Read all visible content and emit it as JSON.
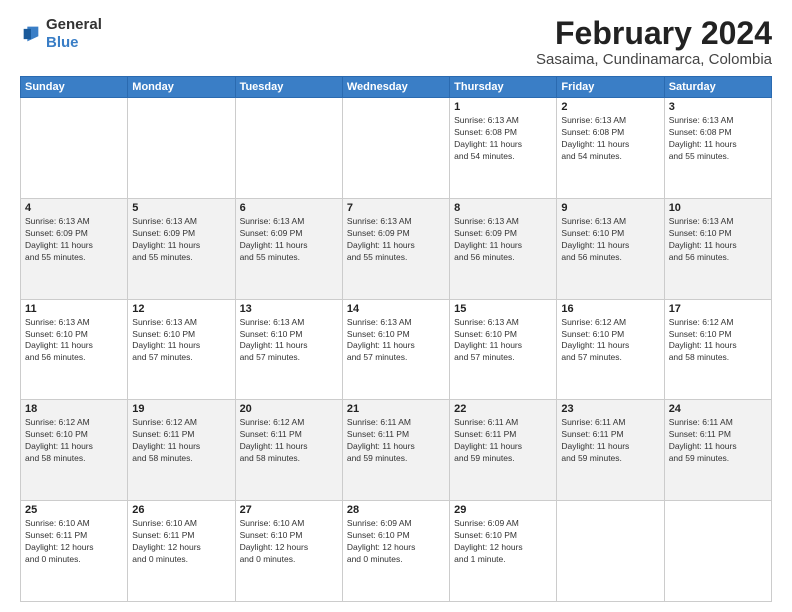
{
  "logo": {
    "general": "General",
    "blue": "Blue"
  },
  "title": {
    "month": "February 2024",
    "location": "Sasaima, Cundinamarca, Colombia"
  },
  "weekdays": [
    "Sunday",
    "Monday",
    "Tuesday",
    "Wednesday",
    "Thursday",
    "Friday",
    "Saturday"
  ],
  "weeks": [
    [
      {
        "day": "",
        "info": ""
      },
      {
        "day": "",
        "info": ""
      },
      {
        "day": "",
        "info": ""
      },
      {
        "day": "",
        "info": ""
      },
      {
        "day": "1",
        "info": "Sunrise: 6:13 AM\nSunset: 6:08 PM\nDaylight: 11 hours\nand 54 minutes."
      },
      {
        "day": "2",
        "info": "Sunrise: 6:13 AM\nSunset: 6:08 PM\nDaylight: 11 hours\nand 54 minutes."
      },
      {
        "day": "3",
        "info": "Sunrise: 6:13 AM\nSunset: 6:08 PM\nDaylight: 11 hours\nand 55 minutes."
      }
    ],
    [
      {
        "day": "4",
        "info": "Sunrise: 6:13 AM\nSunset: 6:09 PM\nDaylight: 11 hours\nand 55 minutes."
      },
      {
        "day": "5",
        "info": "Sunrise: 6:13 AM\nSunset: 6:09 PM\nDaylight: 11 hours\nand 55 minutes."
      },
      {
        "day": "6",
        "info": "Sunrise: 6:13 AM\nSunset: 6:09 PM\nDaylight: 11 hours\nand 55 minutes."
      },
      {
        "day": "7",
        "info": "Sunrise: 6:13 AM\nSunset: 6:09 PM\nDaylight: 11 hours\nand 55 minutes."
      },
      {
        "day": "8",
        "info": "Sunrise: 6:13 AM\nSunset: 6:09 PM\nDaylight: 11 hours\nand 56 minutes."
      },
      {
        "day": "9",
        "info": "Sunrise: 6:13 AM\nSunset: 6:10 PM\nDaylight: 11 hours\nand 56 minutes."
      },
      {
        "day": "10",
        "info": "Sunrise: 6:13 AM\nSunset: 6:10 PM\nDaylight: 11 hours\nand 56 minutes."
      }
    ],
    [
      {
        "day": "11",
        "info": "Sunrise: 6:13 AM\nSunset: 6:10 PM\nDaylight: 11 hours\nand 56 minutes."
      },
      {
        "day": "12",
        "info": "Sunrise: 6:13 AM\nSunset: 6:10 PM\nDaylight: 11 hours\nand 57 minutes."
      },
      {
        "day": "13",
        "info": "Sunrise: 6:13 AM\nSunset: 6:10 PM\nDaylight: 11 hours\nand 57 minutes."
      },
      {
        "day": "14",
        "info": "Sunrise: 6:13 AM\nSunset: 6:10 PM\nDaylight: 11 hours\nand 57 minutes."
      },
      {
        "day": "15",
        "info": "Sunrise: 6:13 AM\nSunset: 6:10 PM\nDaylight: 11 hours\nand 57 minutes."
      },
      {
        "day": "16",
        "info": "Sunrise: 6:12 AM\nSunset: 6:10 PM\nDaylight: 11 hours\nand 57 minutes."
      },
      {
        "day": "17",
        "info": "Sunrise: 6:12 AM\nSunset: 6:10 PM\nDaylight: 11 hours\nand 58 minutes."
      }
    ],
    [
      {
        "day": "18",
        "info": "Sunrise: 6:12 AM\nSunset: 6:10 PM\nDaylight: 11 hours\nand 58 minutes."
      },
      {
        "day": "19",
        "info": "Sunrise: 6:12 AM\nSunset: 6:11 PM\nDaylight: 11 hours\nand 58 minutes."
      },
      {
        "day": "20",
        "info": "Sunrise: 6:12 AM\nSunset: 6:11 PM\nDaylight: 11 hours\nand 58 minutes."
      },
      {
        "day": "21",
        "info": "Sunrise: 6:11 AM\nSunset: 6:11 PM\nDaylight: 11 hours\nand 59 minutes."
      },
      {
        "day": "22",
        "info": "Sunrise: 6:11 AM\nSunset: 6:11 PM\nDaylight: 11 hours\nand 59 minutes."
      },
      {
        "day": "23",
        "info": "Sunrise: 6:11 AM\nSunset: 6:11 PM\nDaylight: 11 hours\nand 59 minutes."
      },
      {
        "day": "24",
        "info": "Sunrise: 6:11 AM\nSunset: 6:11 PM\nDaylight: 11 hours\nand 59 minutes."
      }
    ],
    [
      {
        "day": "25",
        "info": "Sunrise: 6:10 AM\nSunset: 6:11 PM\nDaylight: 12 hours\nand 0 minutes."
      },
      {
        "day": "26",
        "info": "Sunrise: 6:10 AM\nSunset: 6:11 PM\nDaylight: 12 hours\nand 0 minutes."
      },
      {
        "day": "27",
        "info": "Sunrise: 6:10 AM\nSunset: 6:10 PM\nDaylight: 12 hours\nand 0 minutes."
      },
      {
        "day": "28",
        "info": "Sunrise: 6:09 AM\nSunset: 6:10 PM\nDaylight: 12 hours\nand 0 minutes."
      },
      {
        "day": "29",
        "info": "Sunrise: 6:09 AM\nSunset: 6:10 PM\nDaylight: 12 hours\nand 1 minute."
      },
      {
        "day": "",
        "info": ""
      },
      {
        "day": "",
        "info": ""
      }
    ]
  ]
}
